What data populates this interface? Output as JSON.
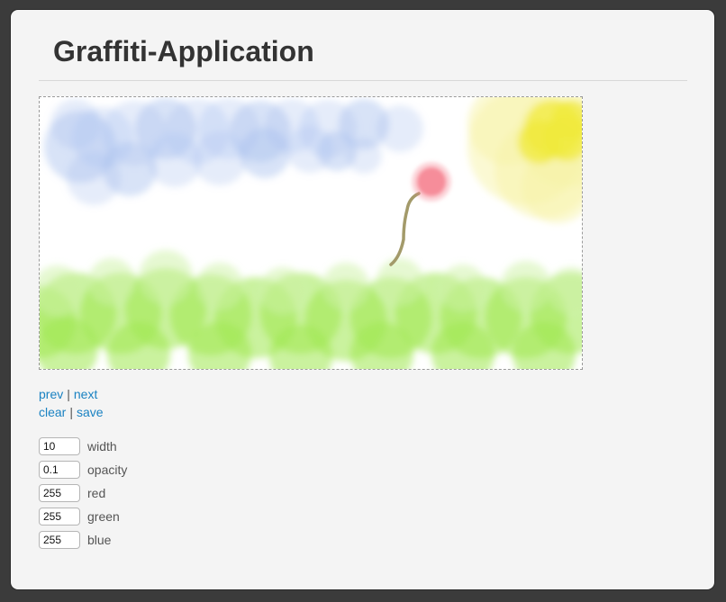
{
  "app": {
    "title": "Graffiti-Application"
  },
  "nav": {
    "prev": "prev",
    "next": "next",
    "clear": "clear",
    "save": "save",
    "separator": "|"
  },
  "controls": [
    {
      "label": "width",
      "value": "10"
    },
    {
      "label": "opacity",
      "value": "0.1"
    },
    {
      "label": "red",
      "value": "255"
    },
    {
      "label": "green",
      "value": "255"
    },
    {
      "label": "blue",
      "value": "255"
    }
  ],
  "colors": {
    "sky": "#a9c1ee",
    "sun": "#f0ea3c",
    "sun_halo": "#f7f3a8",
    "grass": "#9ee84f",
    "grass_light": "#cdf2a6",
    "balloon": "#f5818f",
    "string": "#a39a6a",
    "link": "#1a82c2"
  }
}
